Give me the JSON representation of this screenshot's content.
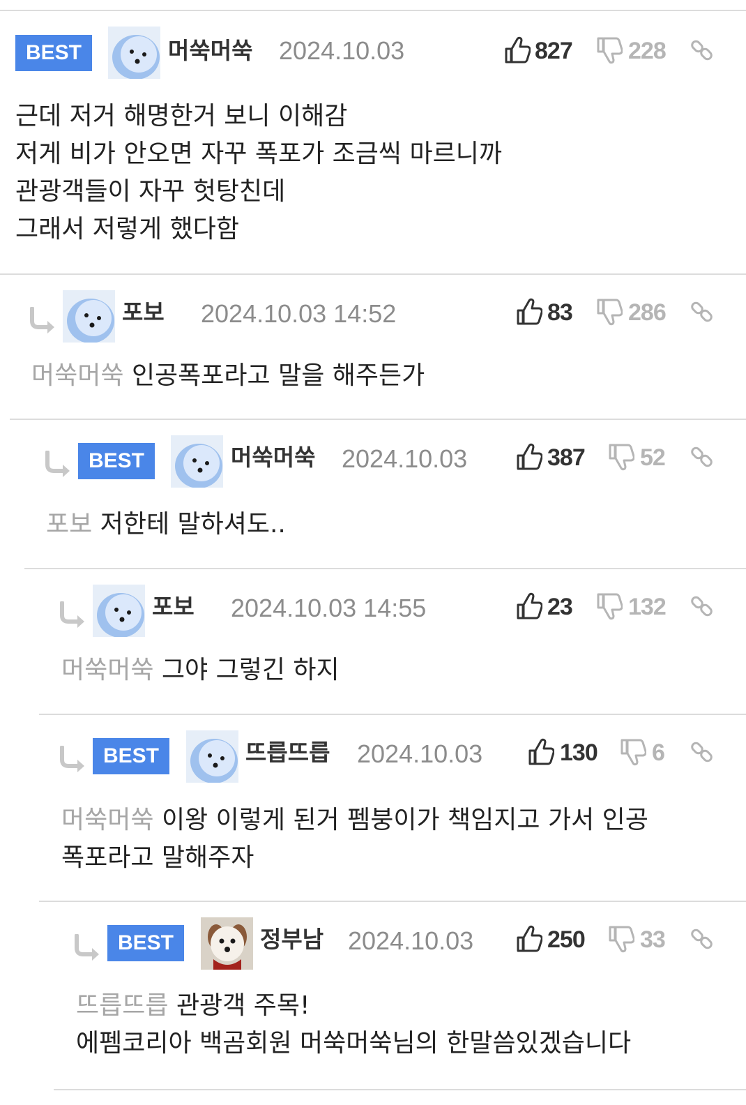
{
  "comments": [
    {
      "best": true,
      "best_label": "BEST",
      "nickname": "머쑥머쑥",
      "date": "2024.10.03",
      "likes": "827",
      "dislikes": "228",
      "mention": "",
      "lines": [
        "근데 저거 해명한거 보니 이해감",
        "저게 비가 안오면 자꾸 폭포가 조금씩 마르니까",
        "관광객들이 자꾸 헛탕친데",
        "그래서 저렇게 했다함"
      ],
      "avatar": "white-dog"
    },
    {
      "best": false,
      "best_label": "",
      "nickname": "포보",
      "date": "2024.10.03 14:52",
      "likes": "83",
      "dislikes": "286",
      "mention": "머쑥머쑥",
      "lines": [
        "인공폭포라고 말을 해주든가"
      ],
      "avatar": "white-dog"
    },
    {
      "best": true,
      "best_label": "BEST",
      "nickname": "머쑥머쑥",
      "date": "2024.10.03",
      "likes": "387",
      "dislikes": "52",
      "mention": "포보",
      "lines": [
        "저한테 말하셔도.."
      ],
      "avatar": "white-dog"
    },
    {
      "best": false,
      "best_label": "",
      "nickname": "포보",
      "date": "2024.10.03 14:55",
      "likes": "23",
      "dislikes": "132",
      "mention": "머쑥머쑥",
      "lines": [
        "그야 그렇긴 하지"
      ],
      "avatar": "white-dog"
    },
    {
      "best": true,
      "best_label": "BEST",
      "nickname": "뜨릅뜨릅",
      "date": "2024.10.03",
      "likes": "130",
      "dislikes": "6",
      "mention": "머쑥머쑥",
      "lines": [
        "이왕 이렇게 된거 펨붕이가 책임지고 가서 인공",
        "폭포라고 말해주자"
      ],
      "avatar": "white-dog"
    },
    {
      "best": true,
      "best_label": "BEST",
      "nickname": "정부남",
      "date": "2024.10.03",
      "likes": "250",
      "dislikes": "33",
      "mention": "뜨릅뜨릅",
      "lines": [
        "관광객 주목!",
        "에펨코리아 백곰회원 머쑥머쑥님의 한말씀있겠습니다"
      ],
      "avatar": "brown-dog"
    }
  ],
  "colors": {
    "best_badge": "#4a86e8",
    "mention": "#a6a6a6",
    "date": "#8c8c8c",
    "separator": "#dcdcdc"
  }
}
